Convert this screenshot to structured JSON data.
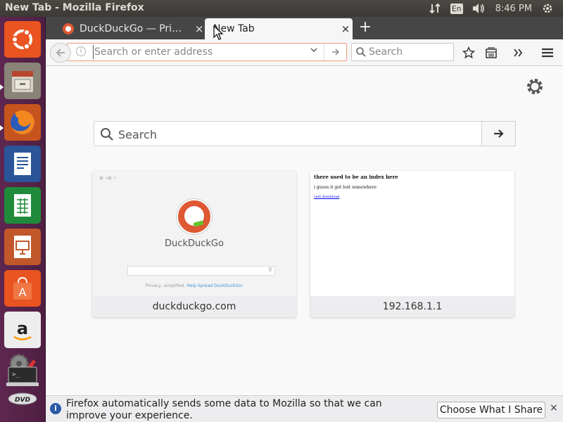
{
  "window": {
    "title": "New Tab - Mozilla Firefox"
  },
  "panel": {
    "keyboard": "En",
    "clock": "8:46 PM"
  },
  "launcher": {
    "items": [
      {
        "name": "dash-home",
        "color": "#e95420"
      },
      {
        "name": "files",
        "color": "#c9c2b6"
      },
      {
        "name": "firefox",
        "color": "#e66000"
      },
      {
        "name": "libreoffice-writer",
        "color": "#2a5599"
      },
      {
        "name": "libreoffice-calc",
        "color": "#1f8b3a"
      },
      {
        "name": "libreoffice-impress",
        "color": "#c1572a"
      },
      {
        "name": "ubuntu-software",
        "color": "#e95420"
      },
      {
        "name": "amazon",
        "color": "#3a3a3a"
      },
      {
        "name": "system-settings",
        "color": "#6b6b6b"
      },
      {
        "name": "terminal",
        "color": "#2b2b2b"
      },
      {
        "name": "dvd",
        "color": "#3a3a3a"
      }
    ],
    "dvd_label": "DVD"
  },
  "tabs": [
    {
      "label": "DuckDuckGo — Pri…",
      "close": "×"
    },
    {
      "label": "New Tab",
      "close": "×"
    }
  ],
  "new_tab_symbol": "+",
  "navbar": {
    "url_placeholder": "Search or enter address",
    "search_placeholder": "Search"
  },
  "content": {
    "search_placeholder": "Search",
    "tiles": [
      {
        "label": "duckduckgo.com",
        "preview_brand": "DuckDuckGo",
        "preview_footer_a": "Privacy, simplified.",
        "preview_footer_b": "Help Spread DuckDuckGo!"
      },
      {
        "label": "192.168.1.1",
        "preview_heading": "there used to be an index here",
        "preview_text": "i guess it got lost somewhere",
        "preview_link": "cert download"
      }
    ]
  },
  "notification": {
    "message": "Firefox automatically sends some data to Mozilla so that we can improve your experience.",
    "button": "Choose What I Share",
    "close": "×",
    "info_glyph": "i"
  },
  "colors": {
    "launcher_bg": "#5e2750",
    "tabbar_bg": "#464646",
    "ddg_orange": "#de5833",
    "urlbar_border": "#e8a07c"
  }
}
